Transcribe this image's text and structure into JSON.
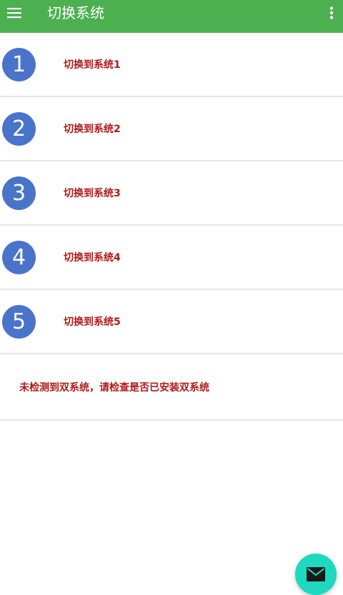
{
  "colors": {
    "appbar": "#4caf50",
    "accent_text": "#b01919",
    "number_icon": "#4a74c9",
    "fab": "#1ed8c2"
  },
  "appbar": {
    "title": "切换系统",
    "menu_icon": "hamburger-menu-icon",
    "overflow_icon": "more-vert-icon"
  },
  "systems": [
    {
      "number": "1",
      "label": "切换到系统1"
    },
    {
      "number": "2",
      "label": "切换到系统2"
    },
    {
      "number": "3",
      "label": "切换到系统3"
    },
    {
      "number": "4",
      "label": "切换到系统4"
    },
    {
      "number": "5",
      "label": "切换到系统5"
    }
  ],
  "status": {
    "message": "未检测到双系统，请检查是否已安装双系统"
  },
  "fab": {
    "icon": "mail-icon"
  }
}
